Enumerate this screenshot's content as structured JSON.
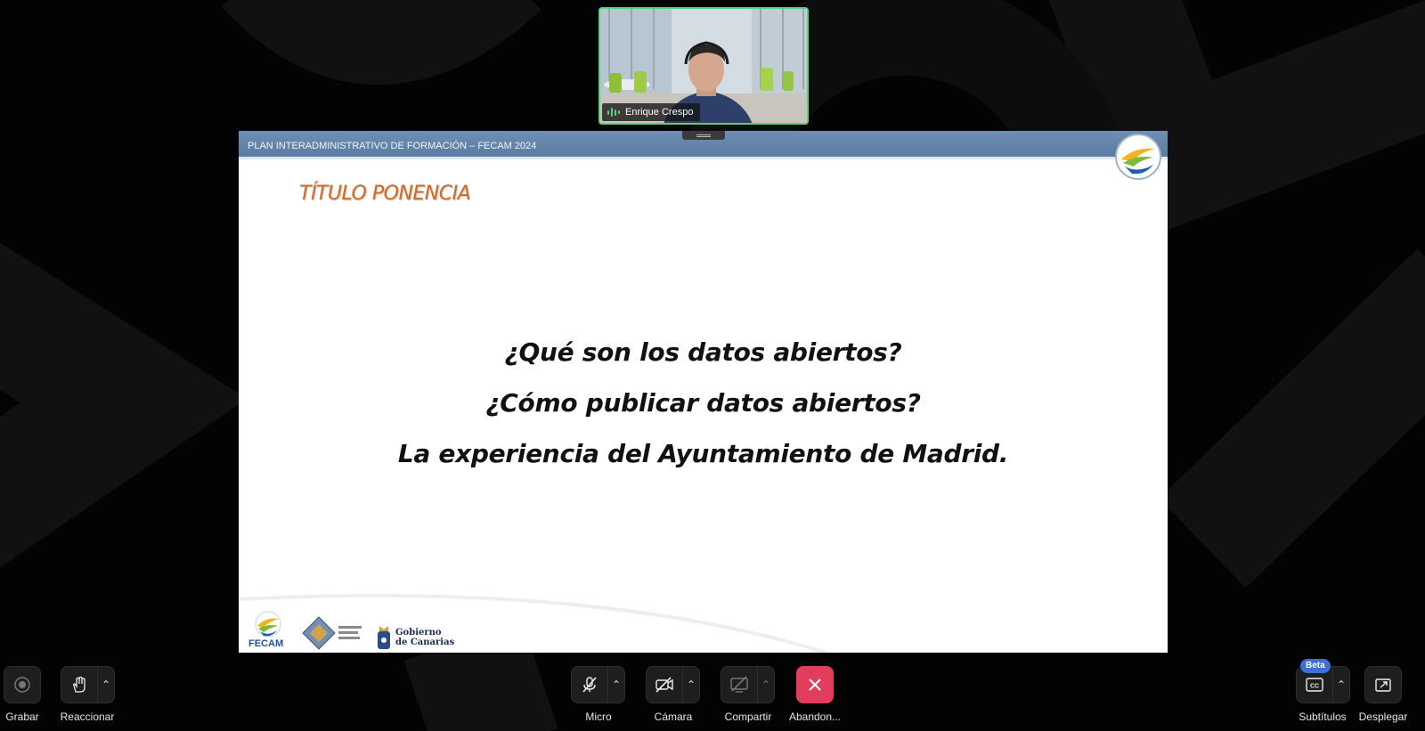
{
  "participant": {
    "name": "Enrique Crespo"
  },
  "slide": {
    "header_title": "PLAN INTERADMINISTRATIVO DE FORMACIÓN – FECAM 2024",
    "section_title": "TÍTULO PONENCIA",
    "lines": [
      "¿Qué son los datos abiertos?",
      "¿Cómo publicar datos abiertos?",
      "La experiencia del Ayuntamiento de Madrid."
    ],
    "footer_logos": {
      "fecam": "FECAM",
      "gobierno": "Gobierno",
      "canarias": "de Canarias"
    }
  },
  "toolbar": {
    "record_label": "Grabar",
    "react_label": "Reaccionar",
    "mic_label": "Micro",
    "camera_label": "Cámara",
    "share_label": "Compartir",
    "leave_label": "Abandon...",
    "captions_label": "Subtítulos",
    "captions_badge": "Beta",
    "popout_label": "Desplegar"
  },
  "colors": {
    "accent_green": "#5ad27c",
    "leave_red": "#e23d5d",
    "slide_header_blue": "#5a7ca3",
    "title_orange": "#d6691e",
    "beta_blue": "#3d6fd6"
  }
}
